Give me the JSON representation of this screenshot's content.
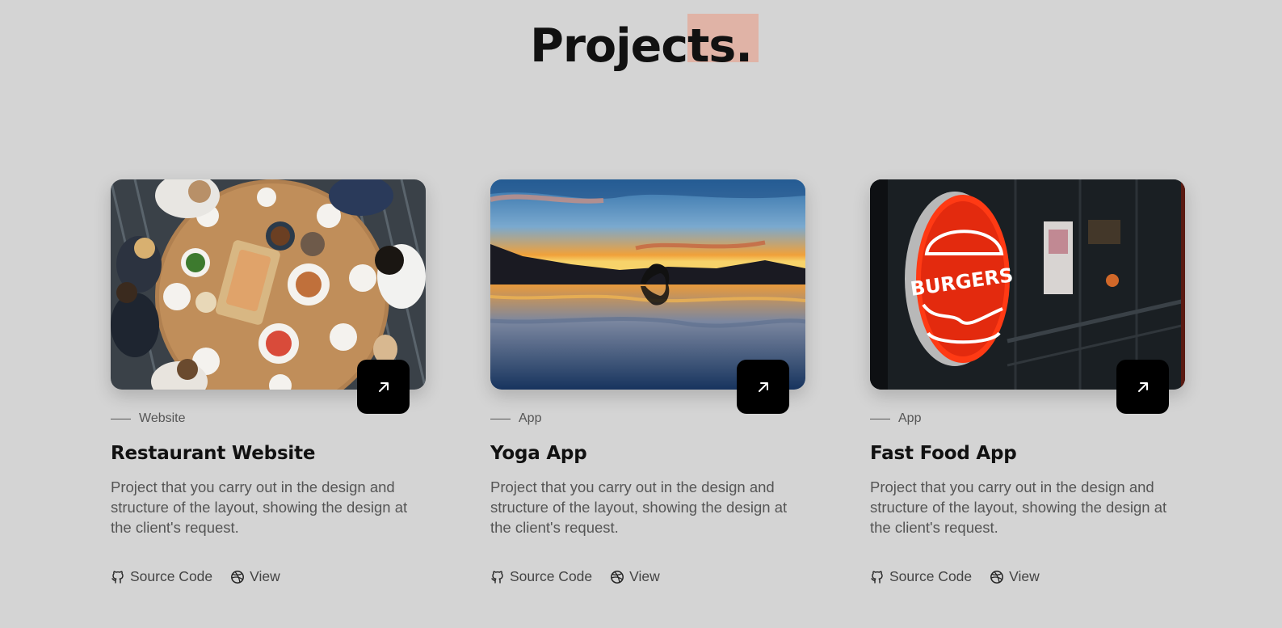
{
  "header": {
    "title": "Projects.",
    "accent_color": "#e0b3a6"
  },
  "projects": [
    {
      "category": "Website",
      "title": "Restaurant Website",
      "description": "Project that you carry out in the design and structure of the layout, showing the design at the client's request.",
      "image": "restaurant-table-photo",
      "links": {
        "source": "Source Code",
        "view": "View"
      }
    },
    {
      "category": "App",
      "title": "Yoga App",
      "description": "Project that you carry out in the design and structure of the layout, showing the design at the client's request.",
      "image": "yoga-sunset-photo",
      "links": {
        "source": "Source Code",
        "view": "View"
      }
    },
    {
      "category": "App",
      "title": "Fast Food App",
      "description": "Project that you carry out in the design and structure of the layout, showing the design at the client's request.",
      "image": "burger-sign-photo",
      "links": {
        "source": "Source Code",
        "view": "View"
      }
    }
  ],
  "icons": {
    "arrow": "arrow-up-right-icon",
    "source": "github-icon",
    "view": "dribbble-icon"
  },
  "colors": {
    "background": "#d4d4d4",
    "button": "#000000",
    "burger_sign": "#e8341c"
  }
}
